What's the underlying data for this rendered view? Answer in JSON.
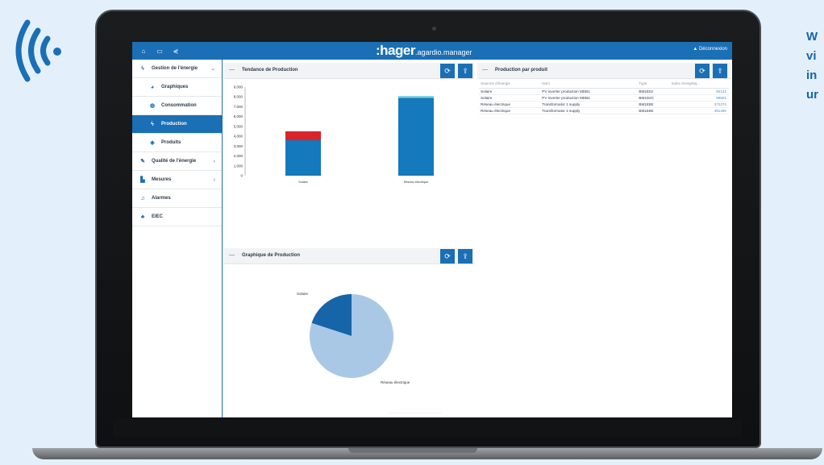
{
  "marketing": {
    "text_lines": [
      "W",
      "vi",
      "in",
      "ur"
    ]
  },
  "colors": {
    "brand_blue": "#1a6fb5",
    "bar_blue": "#1479bd",
    "bar_red": "#d9242c",
    "pie_light": "#a9c8e6",
    "pie_dark": "#1565a8"
  },
  "app": {
    "brand_main": ":hager",
    "brand_sub": ".agardio.manager",
    "user_label": "Déconnexion",
    "topbar_icons": [
      "home-icon",
      "monitor-icon",
      "share-icon"
    ]
  },
  "sidebar": {
    "items": [
      {
        "label": "Gestion de l'énergie",
        "icon": "bolt-icon",
        "sub": false,
        "active": false,
        "chevron": "⌄"
      },
      {
        "label": "Graphiques",
        "icon": "chart-icon",
        "sub": true,
        "active": false,
        "chevron": ""
      },
      {
        "label": "Consommation",
        "icon": "meter-icon",
        "sub": true,
        "active": false,
        "chevron": ""
      },
      {
        "label": "Production",
        "icon": "bolt-icon",
        "sub": true,
        "active": true,
        "chevron": ""
      },
      {
        "label": "Produits",
        "icon": "box-icon",
        "sub": true,
        "active": false,
        "chevron": ""
      },
      {
        "label": "Qualité de l'énergie",
        "icon": "plug-icon",
        "sub": false,
        "active": false,
        "chevron": "›"
      },
      {
        "label": "Mesures",
        "icon": "bars-icon",
        "sub": false,
        "active": false,
        "chevron": "›"
      },
      {
        "label": "Alarmes",
        "icon": "bell-icon",
        "sub": false,
        "active": false,
        "chevron": ""
      },
      {
        "label": "EIEC",
        "icon": "tree-icon",
        "sub": false,
        "active": false,
        "chevron": ""
      }
    ]
  },
  "panels": {
    "trend_title": "Tendance de Production",
    "production_table_title": "Production par produit",
    "pie_title": "Graphique de Production"
  },
  "production_table": {
    "headers": [
      "Sources d'énergie",
      "Nom",
      "Type",
      "Index énergétiq..."
    ],
    "rows": [
      [
        "Solaire",
        "PV inverter production MDB1",
        "BM1E02",
        "92142"
      ],
      [
        "Solaire",
        "PV inverter production MDB2",
        "BM1D4C",
        "99601"
      ],
      [
        "Réseau électrique",
        "Transformator 1 supply",
        "BM1E8E",
        "372274"
      ],
      [
        "Réseau électrique",
        "Transformator 2 supply",
        "BM1E8E",
        "491490"
      ]
    ]
  },
  "chart_data": [
    {
      "type": "bar",
      "title": "Tendance de Production",
      "categories": [
        "Solaire",
        "Réseau électrique"
      ],
      "series": [
        {
          "values": [
            3600,
            7900
          ]
        },
        {
          "values": [
            900,
            0
          ]
        },
        {
          "values": [
            0,
            200
          ]
        }
      ],
      "y_ticks": [
        "0",
        "1,000",
        "2,000",
        "3,000",
        "4,000",
        "5,000",
        "6,000",
        "7,000",
        "8,000",
        "9,000"
      ],
      "ylim": [
        0,
        9000
      ],
      "stacked": true
    },
    {
      "type": "pie",
      "title": "Graphique de Production",
      "labels": [
        "Solaire",
        "Réseau électrique"
      ],
      "values": [
        20,
        80
      ]
    }
  ]
}
